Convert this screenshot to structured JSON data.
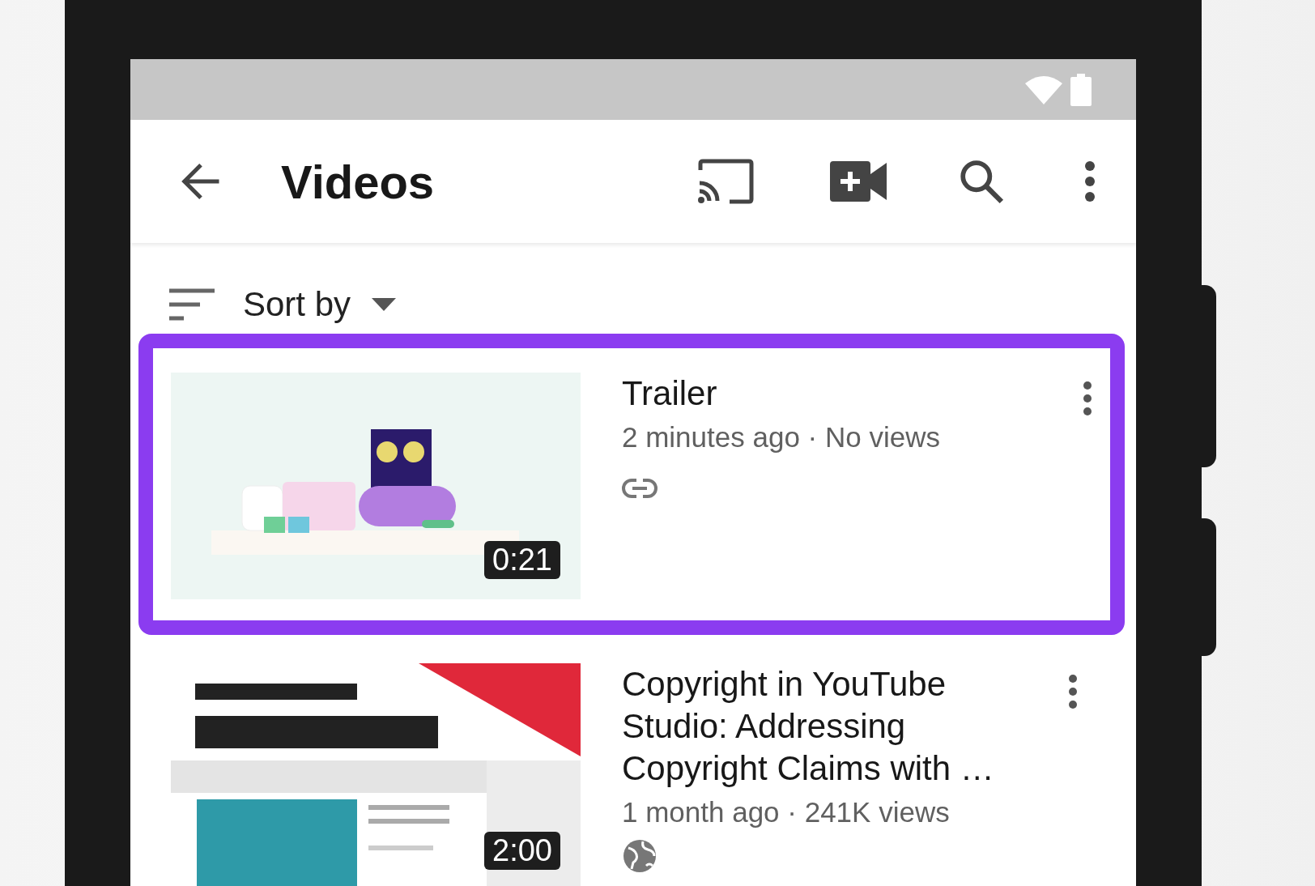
{
  "app_bar": {
    "title": "Videos"
  },
  "sort": {
    "label": "Sort by"
  },
  "videos": [
    {
      "title": "Trailer",
      "meta": "2 minutes ago · No views",
      "duration": "0:21",
      "kind": "unlisted",
      "selected": true
    },
    {
      "title": "Copyright in YouTube Studio: Addressing Copyright Claims with …",
      "meta": "1 month ago · 241K views",
      "duration": "2:00",
      "kind": "public",
      "selected": false
    }
  ]
}
